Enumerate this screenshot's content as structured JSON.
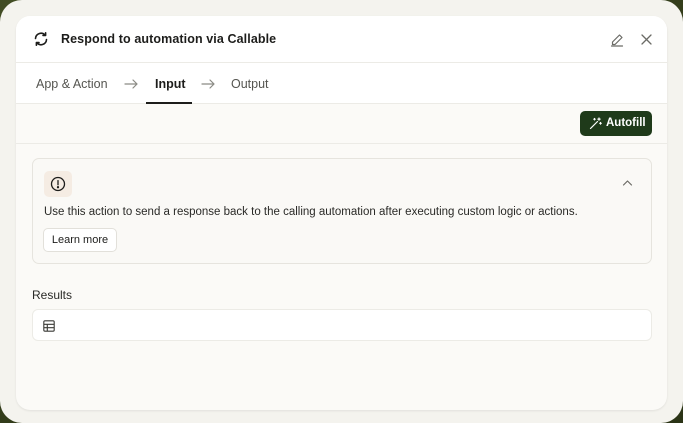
{
  "dialog": {
    "title": "Respond to automation via Callable"
  },
  "stepper": {
    "steps": [
      {
        "label": "App & Action",
        "active": false
      },
      {
        "label": "Input",
        "active": true
      },
      {
        "label": "Output",
        "active": false
      }
    ]
  },
  "toolbar": {
    "autofill_label": "Autofill"
  },
  "info": {
    "description": "Use this action to send a response back to the calling automation after executing custom logic or actions.",
    "learn_more_label": "Learn more"
  },
  "results": {
    "label": "Results"
  },
  "colors": {
    "accent": "#1f3a1a",
    "background_frame": "#3c4720",
    "alert_badge_bg": "#f5ece3"
  },
  "icons": {
    "header": "sync-icon",
    "edit": "pencil-icon",
    "close": "close-icon",
    "autofill": "wand-icon",
    "alert": "alert-circle-icon",
    "collapse": "chevron-up-icon",
    "results": "table-icon"
  }
}
